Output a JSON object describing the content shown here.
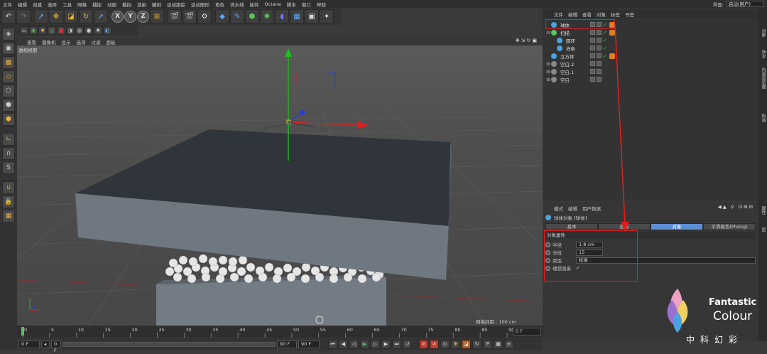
{
  "menubar": {
    "items": [
      "文件",
      "编辑",
      "创建",
      "选择",
      "工具",
      "网格",
      "捕捉",
      "动画",
      "模拟",
      "渲染",
      "雕刻",
      "运动跟踪",
      "运动图形",
      "角色",
      "流水线",
      "插件",
      "Octane",
      "脚本",
      "窗口",
      "帮助"
    ],
    "layout_label": "界面:",
    "layout_value": "启动(用户)"
  },
  "toolbar": {
    "axis_buttons": [
      "X",
      "Y",
      "Z"
    ]
  },
  "viewport": {
    "menu": [
      "查看",
      "摄像机",
      "显示",
      "选项",
      "过滤",
      "面板"
    ],
    "label": "透视视图",
    "grid_label": "网格间距 : 100 cm"
  },
  "timeline": {
    "ticks": [
      "0",
      "5",
      "10",
      "15",
      "20",
      "25",
      "30",
      "35",
      "40",
      "45",
      "50",
      "55",
      "60",
      "65",
      "70",
      "75",
      "80",
      "85",
      "90"
    ],
    "current_frame": "0 F"
  },
  "transport": {
    "start": "0 F",
    "min": "0 F",
    "max": "90 F",
    "end": "90 F"
  },
  "object_manager": {
    "menu": [
      "文件",
      "编辑",
      "查看",
      "对象",
      "标签",
      "书签"
    ],
    "objects": [
      {
        "name": "球体",
        "color": "#4aa3e0",
        "indent": 0,
        "check": true,
        "tag": true
      },
      {
        "name": "扫描",
        "color": "#5cc25c",
        "indent": 0,
        "check": true,
        "tag": true
      },
      {
        "name": "圆环",
        "color": "#4aa3e0",
        "indent": 1,
        "check": true,
        "tag": false
      },
      {
        "name": "样条",
        "color": "#4aa3e0",
        "indent": 1,
        "check": true,
        "tag": false
      },
      {
        "name": "立方体",
        "color": "#4aa3e0",
        "indent": 0,
        "check": true,
        "tag": true
      },
      {
        "name": "空白.2",
        "color": "#888888",
        "indent": 0,
        "check": false,
        "tag": false
      },
      {
        "name": "空白.1",
        "color": "#888888",
        "indent": 0,
        "check": false,
        "tag": false
      },
      {
        "name": "空白",
        "color": "#888888",
        "indent": 0,
        "check": false,
        "tag": false
      }
    ]
  },
  "attributes": {
    "menu": [
      "模式",
      "编辑",
      "用户数据"
    ],
    "title": "球体对象 [球体]",
    "tabs": [
      "基本",
      "坐标",
      "对象",
      "平滑着色(Phong)"
    ],
    "active_tab": "对象",
    "section": "对象属性",
    "fields": [
      {
        "label": "半径",
        "value": "1.8 cm"
      },
      {
        "label": "分段",
        "value": "15"
      },
      {
        "label": "类型",
        "value": "标准"
      },
      {
        "label": "理想渲染",
        "value": "✓"
      }
    ]
  },
  "right_tabs": [
    "对象",
    "场次",
    "内容浏览器",
    "构造",
    "属性",
    "层"
  ],
  "watermark": {
    "line1": "Fantastic",
    "line2": "Colour",
    "line3": "中科幻彩"
  },
  "colors": {
    "highlight": "#e02020",
    "accent_tab": "#5c8fd6",
    "axis_x": "#e02020",
    "axis_y": "#20c020",
    "axis_z": "#2040e0"
  }
}
